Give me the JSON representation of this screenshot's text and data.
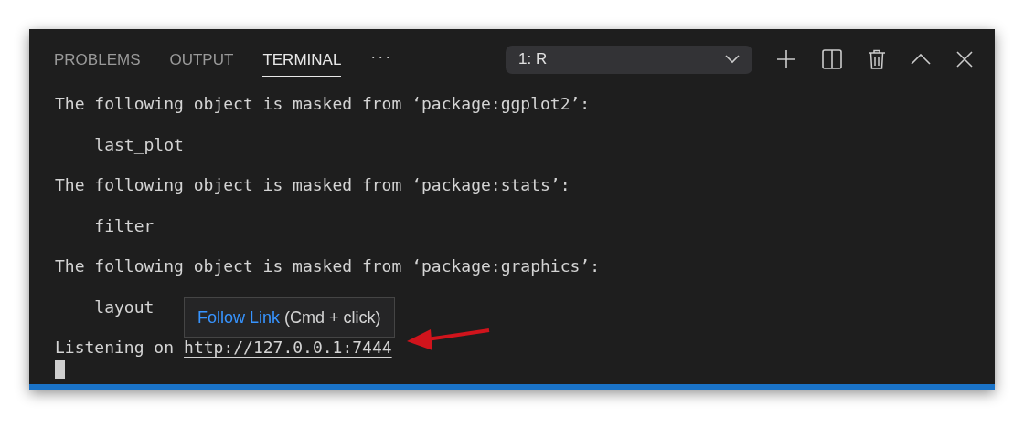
{
  "panel": {
    "tabs": [
      {
        "label": "PROBLEMS",
        "selected": false
      },
      {
        "label": "OUTPUT",
        "selected": false
      },
      {
        "label": "TERMINAL",
        "selected": true
      }
    ],
    "more": "···",
    "terminal_select": {
      "value": "1: R"
    }
  },
  "terminal": {
    "lines": [
      "The following object is masked from ‘package:ggplot2’:",
      "    last_plot",
      "The following object is masked from ‘package:stats’:",
      "    filter",
      "The following object is masked from ‘package:graphics’:",
      "    layout"
    ],
    "last_line": {
      "prefix": "Listening on",
      "link": "http://127.0.0.1:7444"
    },
    "tooltip": {
      "action": "Follow Link",
      "hint": "(Cmd + click)"
    }
  }
}
